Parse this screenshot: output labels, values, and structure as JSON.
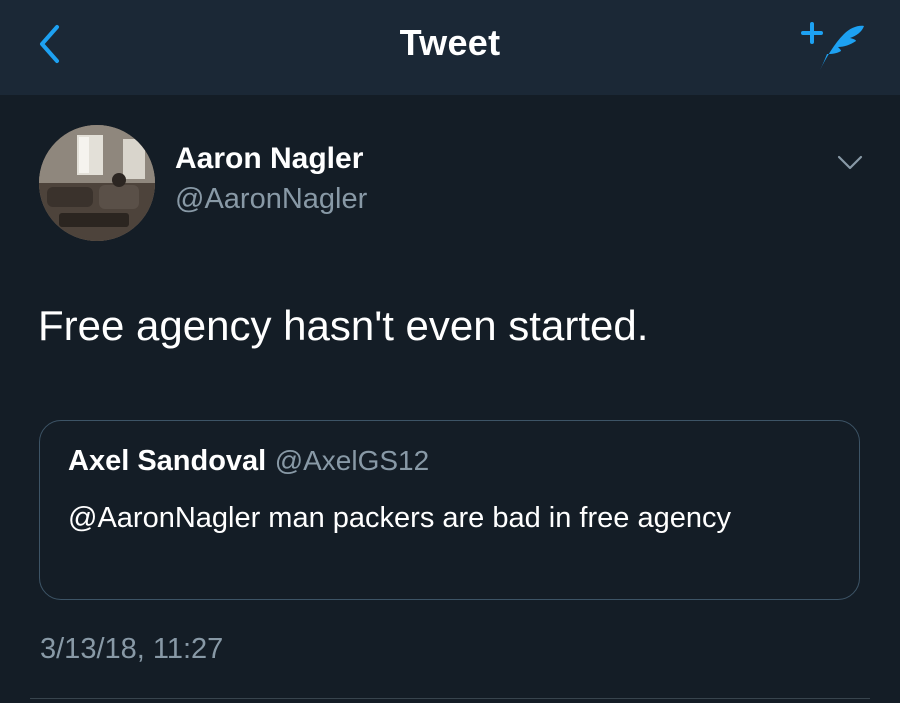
{
  "header": {
    "title": "Tweet",
    "back_icon": "chevron-left-icon",
    "compose_icon": "compose-tweet-icon",
    "accent_color": "#1da1f2"
  },
  "tweet": {
    "author": {
      "name": "Aaron Nagler",
      "handle": "@AaronNagler",
      "avatar": "avatar-photo"
    },
    "menu_icon": "chevron-down-icon",
    "text": "Free agency hasn't even started.",
    "quoted": {
      "name": "Axel Sandoval",
      "handle": "@AxelGS12",
      "text": "@AaronNagler man packers are bad in free agency"
    },
    "timestamp": "3/13/18, 11:27"
  },
  "colors": {
    "background": "#141d26",
    "header_background": "#1b2836",
    "secondary_text": "#8899a6",
    "border": "#3d5466"
  }
}
